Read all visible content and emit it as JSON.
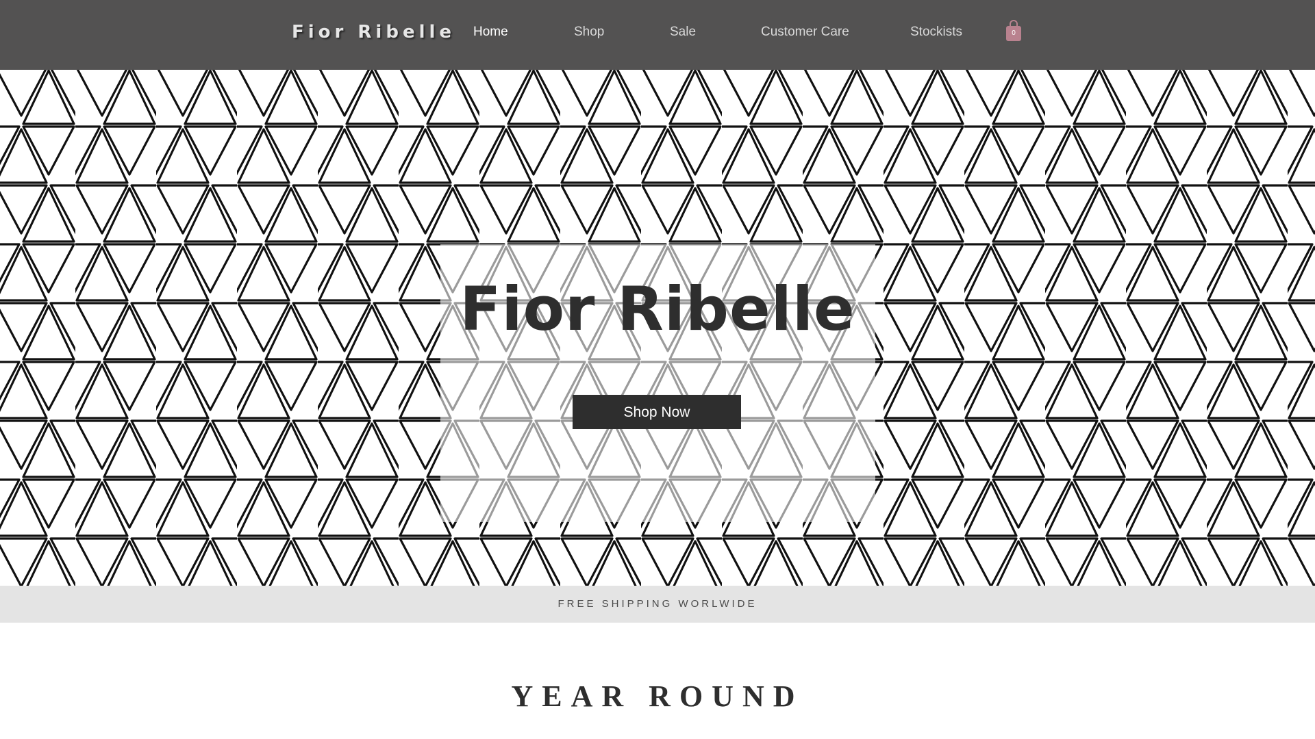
{
  "header": {
    "brand": "Fior Ribelle",
    "nav": [
      {
        "label": "Home",
        "active": true
      },
      {
        "label": "Shop"
      },
      {
        "label": "Sale"
      },
      {
        "label": "Customer Care"
      },
      {
        "label": "Stockists"
      }
    ],
    "cart": {
      "count": "0",
      "icon": "shopping-bag-icon",
      "color": "#b9828f"
    }
  },
  "hero": {
    "title": "Fior Ribelle",
    "button_label": "Shop Now"
  },
  "shipping_banner": {
    "text": "FREE SHIPPING WORLWIDE"
  },
  "section": {
    "title": "YEAR ROUND"
  },
  "colors": {
    "header_bg": "#535252",
    "accent_dark": "#2e2e2e",
    "banner_bg": "#e4e4e4"
  }
}
